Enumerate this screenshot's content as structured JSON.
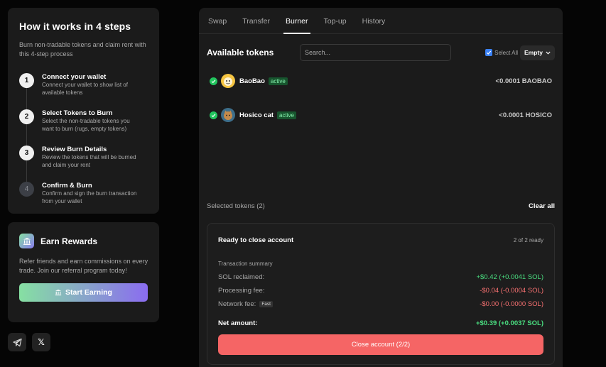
{
  "steps": {
    "title": "How it works in 4 steps",
    "subtitle": "Burn non-tradable tokens and claim rent with this 4-step process",
    "items": [
      {
        "num": "1",
        "title": "Connect your wallet",
        "desc": "Connect your wallet to show list of available tokens"
      },
      {
        "num": "2",
        "title": "Select Tokens to Burn",
        "desc": "Select the non-tradable tokens you want to burn (rugs, empty tokens)"
      },
      {
        "num": "3",
        "title": "Review Burn Details",
        "desc": "Review the tokens that will be burned and claim your rent"
      },
      {
        "num": "4",
        "title": "Confirm & Burn",
        "desc": "Confirm and sign the burn transaction from your wallet"
      }
    ]
  },
  "rewards": {
    "title": "Earn Rewards",
    "desc": "Refer friends and earn commissions on every trade. Join our referral program today!",
    "button": "Start Earning"
  },
  "social": {
    "x_label": "𝕏"
  },
  "tabs": [
    "Swap",
    "Transfer",
    "Burner",
    "Top-up",
    "History"
  ],
  "active_tab": "Burner",
  "available": {
    "title": "Available tokens",
    "search_placeholder": "Search...",
    "select_all": "Select All",
    "filter": "Empty"
  },
  "tokens": [
    {
      "name": "BaoBao",
      "badge": "active",
      "amount": "<0.0001 BAOBAO",
      "avatar_color": "#f5c542"
    },
    {
      "name": "Hosico cat",
      "badge": "active",
      "amount": "<0.0001 HOSICO",
      "avatar_color": "#5a8fb0"
    }
  ],
  "selected": {
    "label": "Selected tokens (2)",
    "clear": "Clear all"
  },
  "summary": {
    "title": "Ready to close account",
    "ready": "2 of 2 ready",
    "subtitle": "Transaction summary",
    "rows": [
      {
        "key": "SOL reclaimed:",
        "value": "+$0.42 (+0.0041 SOL)"
      },
      {
        "key": "Processing fee:",
        "value": "-$0.04 (-0.0004 SOL)"
      },
      {
        "key": "Network fee:",
        "tag": "Fast",
        "value": "-$0.00 (-0.0000 SOL)"
      }
    ],
    "net_key": "Net amount:",
    "net_value": "+$0.39 (+0.0037 SOL)",
    "button": "Close account (2/2)"
  },
  "colors": {
    "positive": "#4ade80",
    "negative": "#f87171",
    "accent": "#f56565"
  }
}
